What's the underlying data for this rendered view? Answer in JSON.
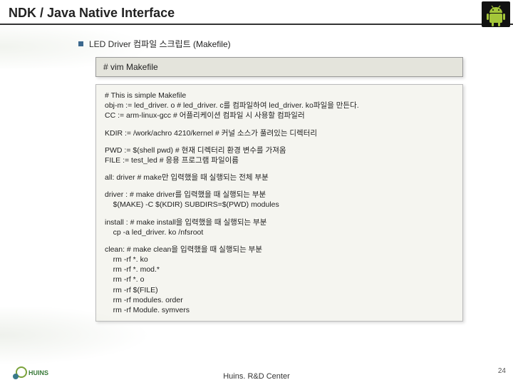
{
  "title": "NDK / Java Native Interface",
  "bullet": "LED Driver 컴파일 스크립트 (Makefile)",
  "vim_cmd": "# vim  Makefile",
  "code": {
    "p1": "# This is simple Makefile\nobj-m := led_driver. o # led_driver. c를 컴파일하여 led_driver. ko파일을 만든다.\nCC := arm-linux-gcc # 어플리케이션 컴파일 시 사용할 컴파일러",
    "p2": "KDIR := /work/achro 4210/kernel # 커널 소스가 풀려있는 디렉터리",
    "p3": "PWD := $(shell pwd) # 현재 디렉터리 환경 변수를 가져옴\nFILE := test_led # 응용 프로그램 파일이름",
    "p4": "all: driver # make만 입력했을 때 실행되는 전체 부분",
    "p5": "driver : # make driver를 입력했을 때 실행되는 부분\n    $(MAKE) -C $(KDIR) SUBDIRS=$(PWD) modules",
    "p6": "install : # make install을 입력했을 때 실행되는 부분\n    cp -a led_driver. ko /nfsroot",
    "p7": "clean: # make clean을 입력했을 때 실행되는 부분\n    rm -rf *. ko\n    rm -rf *. mod.*\n    rm -rf *. o\n    rm -rf $(FILE)\n    rm -rf modules. order\n    rm -rf Module. symvers"
  },
  "footer": "Huins. R&D Center",
  "page": "24",
  "logo_text": "HUINS"
}
